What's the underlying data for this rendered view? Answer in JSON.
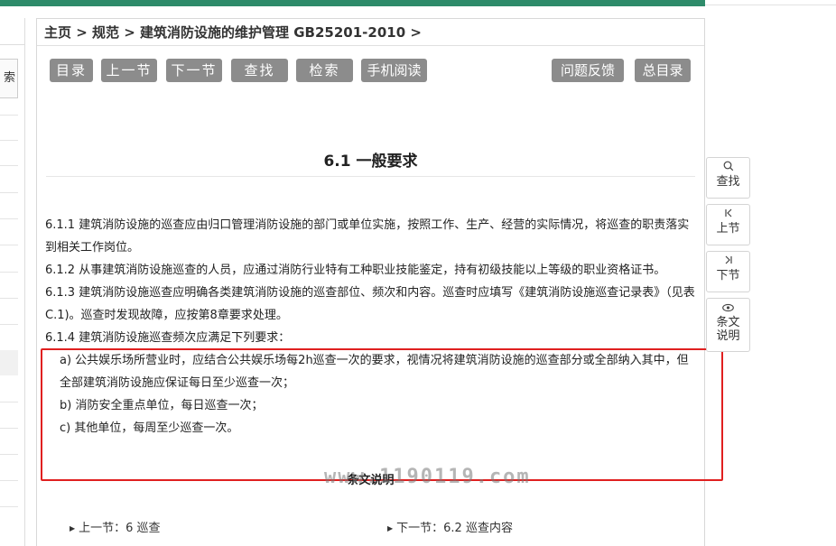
{
  "breadcrumb": "主页 > 规范 > 建筑消防设施的维护管理 GB25201-2010 >",
  "sidebar": {
    "search_fragment": "索"
  },
  "toolbar": {
    "catalog": "目录",
    "prev_section": "上一节",
    "next_section": "下一节",
    "find": "查找",
    "search": "检索",
    "mobile_read": "手机阅读",
    "feedback": "问题反馈",
    "master_catalog": "总目录"
  },
  "section_title": "6.1 一般要求",
  "paragraphs": {
    "p611": "6.1.1 建筑消防设施的巡查应由归口管理消防设施的部门或单位实施，按照工作、生产、经营的实际情况，将巡查的职责落实到相关工作岗位。",
    "p612": "6.1.2 从事建筑消防设施巡查的人员，应通过消防行业特有工种职业技能鉴定，持有初级技能以上等级的职业资格证书。",
    "p613": "6.1.3 建筑消防设施巡查应明确各类建筑消防设施的巡查部位、频次和内容。巡查时应填写《建筑消防设施巡查记录表》（见表C.1)。巡查时发现故障，应按第8章要求处理。",
    "p614": "6.1.4 建筑消防设施巡查频次应满足下列要求：",
    "p614a": "a) 公共娱乐场所营业时，应结合公共娱乐场每2h巡查一次的要求，视情况将建筑消防设施的巡查部分或全部纳入其中，但全部建筑消防设施应保证每日至少巡查一次；",
    "p614b": "b) 消防安全重点单位，每日巡查一次；",
    "p614c": "c) 其他单位，每周至少巡查一次。"
  },
  "explain_label": "条文说明",
  "watermark": "www.1190119.com",
  "nav": {
    "prev": "上一节：6 巡查",
    "next": "下一节：6.2 巡查内容"
  },
  "side_tools": {
    "find": "查找",
    "prev": "上节",
    "next": "下节",
    "explain_line1": "条文",
    "explain_line2": "说明"
  },
  "colors": {
    "topbar": "#2e8b6a",
    "button": "#8c8c8c",
    "highlight": "#e02020"
  }
}
